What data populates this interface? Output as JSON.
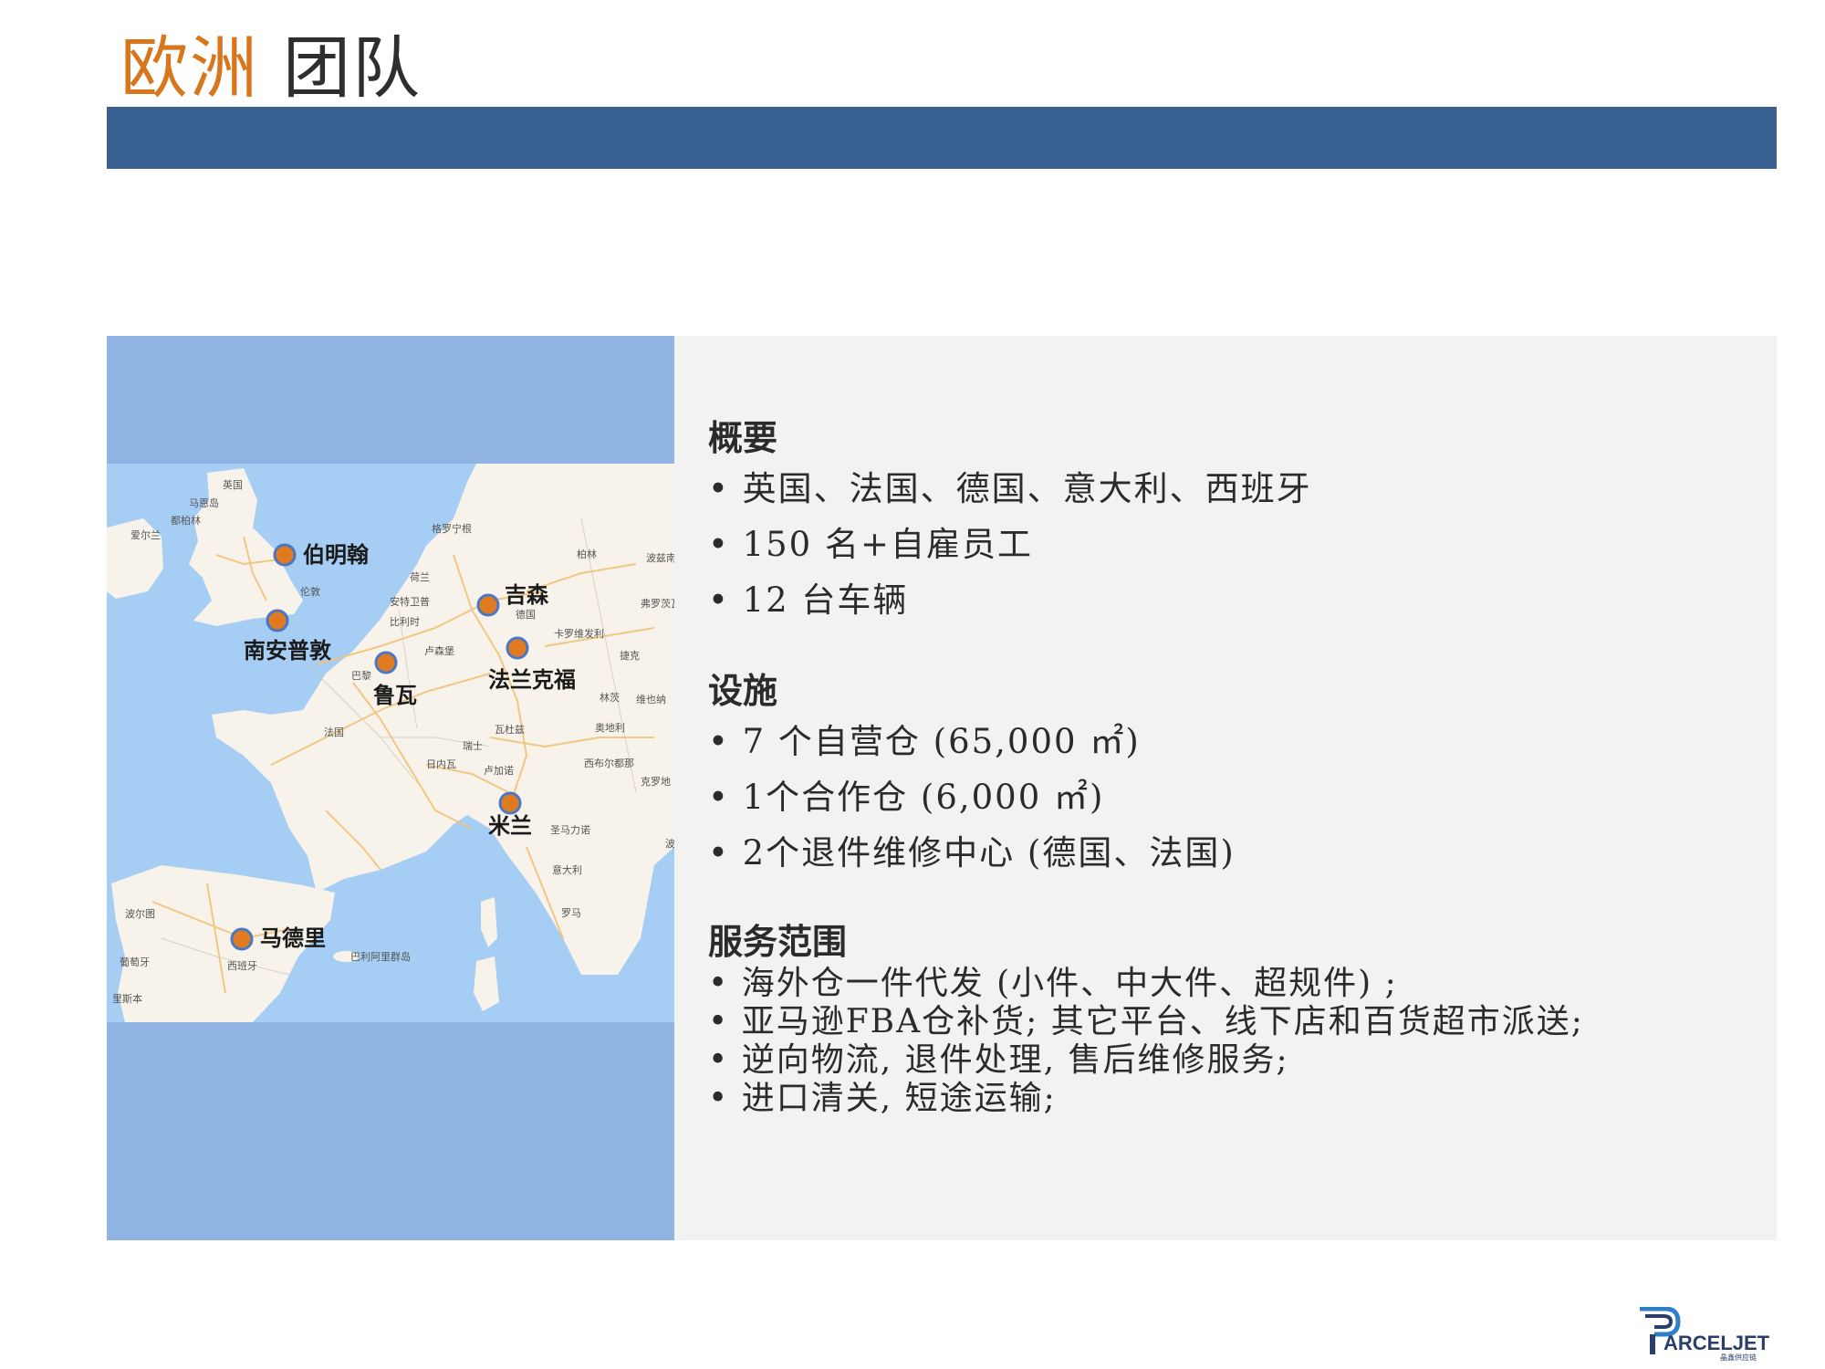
{
  "title": {
    "part1": "欧洲",
    "part2": "团队"
  },
  "map": {
    "cities": [
      {
        "name": "伯明翰"
      },
      {
        "name": "南安普敦"
      },
      {
        "name": "吉森"
      },
      {
        "name": "法兰克福"
      },
      {
        "name": "鲁瓦"
      },
      {
        "name": "米兰"
      },
      {
        "name": "马德里"
      }
    ],
    "labels": [
      "英国",
      "马恩岛",
      "都柏林",
      "爱尔兰",
      "伦敦",
      "荷兰",
      "格罗宁根",
      "安特卫普",
      "比利时",
      "卢森堡",
      "巴黎",
      "法国",
      "德国",
      "柏林",
      "波兹南",
      "弗罗茨瓦夫",
      "卡罗维发利",
      "捷克",
      "林茨",
      "维也纳",
      "奥地利",
      "瓦杜兹",
      "瑞士",
      "日内瓦",
      "卢加诺",
      "西布尔都那",
      "克罗地",
      "圣马力诺",
      "意大利",
      "罗马",
      "波尔图",
      "葡萄牙",
      "西班牙",
      "巴利阿里群岛",
      "里斯本",
      "波"
    ],
    "marker_color": "#e07b22"
  },
  "sections": {
    "overview": {
      "title": "概要",
      "items": [
        "英国、法国、德国、意大利、西班牙",
        "150 名+自雇员工",
        "12 台车辆"
      ]
    },
    "facilities": {
      "title": "设施",
      "items": [
        "7 个自营仓 (65,000 ㎡)",
        "1个合作仓 (6,000 ㎡)",
        " 2个退件维修中心 (德国、法国)"
      ]
    },
    "services": {
      "title": "服务范围",
      "items": [
        "海外仓一件代发 (小件、中大件、超规件) ;",
        "亚马逊FBA仓补货; 其它平台、线下店和百货超市派送;",
        "逆向物流, 退件处理, 售后维修服务;",
        "进口清关, 短途运输;"
      ]
    }
  },
  "logo": {
    "text": "ARCELJET",
    "subtext": "晶鑫供应链"
  },
  "colors": {
    "title_accent": "#d8761e",
    "band": "#386192",
    "left_panel": "#8fb4e3",
    "right_panel": "#f2f2f2"
  }
}
